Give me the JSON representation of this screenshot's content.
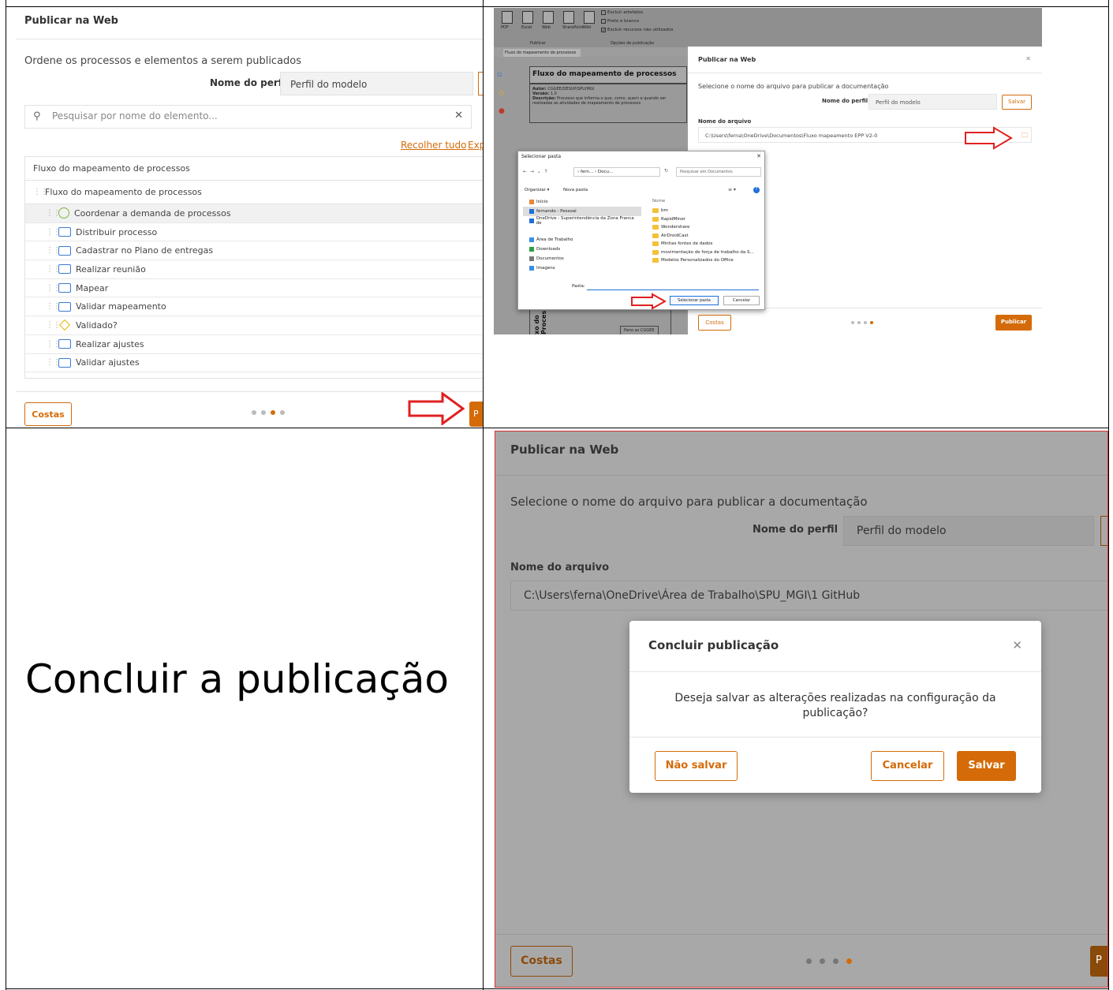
{
  "panel1": {
    "title": "Publicar na Web",
    "subtitle": "Ordene os processos e elementos a serem publicados",
    "profile_label": "Nome do perfil",
    "profile_value": "Perfil do modelo",
    "search_placeholder": "Pesquisar por nome do elemento...",
    "collapse_all": "Recolher tudo",
    "expand_all": "Exp",
    "tree_header": "Fluxo do mapeamento de processos",
    "tree_root": "Fluxo do mapeamento de processos",
    "items": [
      {
        "label": "Coordenar a demanda de processos",
        "icon": "circle"
      },
      {
        "label": "Distribuir processo",
        "icon": "rect"
      },
      {
        "label": "Cadastrar no Plano de entregas",
        "icon": "rect"
      },
      {
        "label": "Realizar reunião",
        "icon": "rect"
      },
      {
        "label": "Mapear",
        "icon": "rect"
      },
      {
        "label": "Validar mapeamento",
        "icon": "rect"
      },
      {
        "label": "Validado?",
        "icon": "diamond"
      },
      {
        "label": "Realizar ajustes",
        "icon": "rect"
      },
      {
        "label": "Validar ajustes",
        "icon": "rect"
      }
    ],
    "back_label": "Costas",
    "next_label": "P",
    "active_step": 3
  },
  "panel2": {
    "ribbon_buttons": [
      "PDF",
      "Excel",
      "Web",
      "SharePoint",
      "Wiki"
    ],
    "ribbon_options": [
      "Excluir artefatos",
      "Preto e branco",
      "Excluir recursos não utilizados"
    ],
    "group_publish": "Publicar",
    "group_options": "Opções de publicação",
    "doc_tab": "Fluxo do mapeamento de processos",
    "bg_title": "Fluxo do mapeamento de processos",
    "bg_meta": {
      "author_label": "Autor:",
      "author": "CGGEE/DESUP/SPU/MGI",
      "version_label": "Versão:",
      "version": "1.0",
      "desc_label": "Descrição:",
      "desc": "Processo que informa o que, como, quem e quando ser realizadas as atividades de mapeamento de processos"
    },
    "bg_side": "xo do Proces",
    "bg_bottom_label": "Pano as CGGEE",
    "dialog_title": "Publicar na Web",
    "dialog_sub": "Selecione o nome do arquivo para publicar a documentação",
    "profile_label": "Nome do perfil",
    "profile_value": "Perfil do modelo",
    "save_label": "Salvar",
    "file_label": "Nome do arquivo",
    "file_value": "C:\\Users\\ferna\\OneDrive\\Documentos\\Fluxo mapeamento EPP V2-0",
    "back_label": "Costas",
    "publish_label": "Publicar",
    "active_step": 4,
    "win": {
      "title": "Selecionar pasta",
      "crumb": "› fern... › Docu...",
      "search": "Pesquisar em Documentos",
      "organize": "Organizar ▾",
      "new_folder": "Nova pasta",
      "left_items": [
        {
          "label": "Início",
          "color": "#e8873a"
        },
        {
          "label": "fernando - Pessoal",
          "color": "#1e6fd9"
        },
        {
          "label": "OneDrive - Superintendência da Zona Franca de",
          "color": "#1e6fd9"
        },
        {
          "label": "",
          "color": ""
        },
        {
          "label": "Área de Trabalho",
          "color": "#3a8ee6"
        },
        {
          "label": "Downloads",
          "color": "#2f9e44"
        },
        {
          "label": "Documentos",
          "color": "#777"
        },
        {
          "label": "Imagens",
          "color": "#3a8ee6"
        }
      ],
      "right_header": "Nome",
      "right_items": [
        "bm",
        "RapidMiner",
        "Wondershare",
        "AirDroidCast",
        "Minhas fontes de dados",
        "movimentação de força de trabalho da S...",
        "Modelos Personalizados do Office"
      ],
      "folder_label": "Pasta:",
      "select_label": "Selecionar pasta",
      "cancel_label": "Cancelar"
    }
  },
  "panel3": {
    "caption": "Concluir a publicação"
  },
  "panel4": {
    "title": "Publicar na Web",
    "subtitle": "Selecione o nome do arquivo para publicar a documentação",
    "profile_label": "Nome do perfil",
    "profile_value": "Perfil do modelo",
    "file_label": "Nome do arquivo",
    "file_value": "C:\\Users\\ferna\\OneDrive\\Área de Trabalho\\SPU_MGI\\1 GitHub",
    "back_label": "Costas",
    "next_label": "P",
    "active_step": 4,
    "modal": {
      "title": "Concluir publicação",
      "message": "Deseja salvar as alterações realizadas na configuração da publicação?",
      "no_save": "Não salvar",
      "cancel": "Cancelar",
      "save": "Salvar"
    }
  },
  "colors": {
    "accent": "#d46b08",
    "arrow": "#e02020",
    "overlay": "#a8a8a8"
  }
}
